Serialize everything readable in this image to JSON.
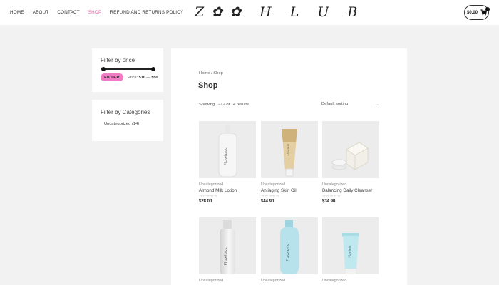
{
  "nav": {
    "items": [
      {
        "label": "HOME",
        "active": false
      },
      {
        "label": "ABOUT",
        "active": false
      },
      {
        "label": "CONTACT",
        "active": false
      },
      {
        "label": "SHOP",
        "active": true
      },
      {
        "label": "REFUND AND RETURNS POLICY",
        "active": false
      }
    ]
  },
  "logo": {
    "text": "Z✿✿ H L U B"
  },
  "cart": {
    "amount": "$0.00"
  },
  "filter_price": {
    "title": "Filter by price",
    "button": "FILTER",
    "range_prefix": "Price:",
    "min": "$10",
    "max": "$50"
  },
  "filter_categories": {
    "title": "Filter by Categories",
    "items": [
      {
        "label": "Uncategorized (14)"
      }
    ]
  },
  "shop": {
    "breadcrumb": "Home / Shop",
    "title": "Shop",
    "result_count": "Showing 1–12 of 14 results",
    "sorting": "Default sorting"
  },
  "products": [
    {
      "category": "Uncategorized",
      "name": "Almond Milk Lotion",
      "price": "$28.00",
      "stars": "☆☆☆☆☆",
      "brand": "Flawless",
      "image": "tall-bottle-white"
    },
    {
      "category": "Uncategorized",
      "name": "Antiaging Skin Oil",
      "price": "$44.90",
      "stars": "☆☆☆☆☆",
      "brand": "Flawless",
      "image": "tube-gold"
    },
    {
      "category": "Uncategorized",
      "name": "Balancing Daily Cleanser",
      "price": "$34.90",
      "stars": "☆☆☆☆☆",
      "brand": "",
      "image": "cream-box"
    },
    {
      "category": "Uncategorized",
      "name": "",
      "price": "",
      "stars": "",
      "brand": "Flawless",
      "image": "bottle-white-gradient"
    },
    {
      "category": "Uncategorized",
      "name": "",
      "price": "",
      "stars": "",
      "brand": "Flawless",
      "image": "bottle-light-blue"
    },
    {
      "category": "Uncategorized",
      "name": "",
      "price": "",
      "stars": "",
      "brand": "Flawless",
      "image": "tube-light-blue"
    }
  ],
  "colors": {
    "accent": "#e75fa8",
    "filter_button": "#f07ac3"
  }
}
